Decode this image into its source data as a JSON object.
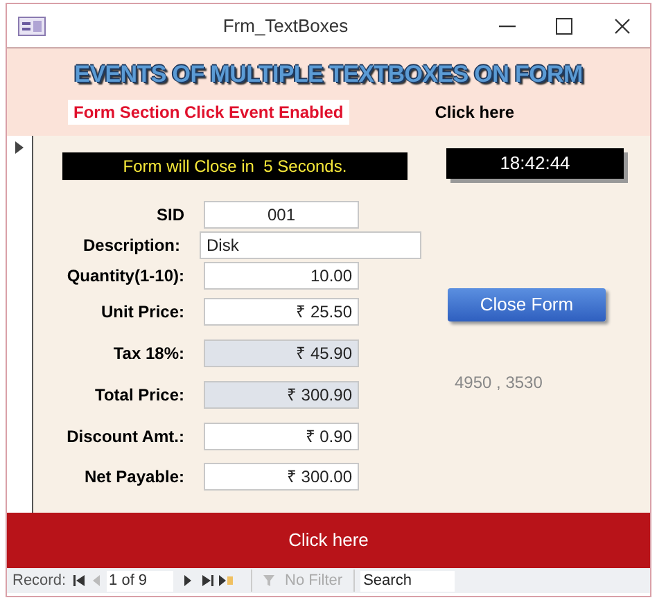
{
  "window": {
    "title": "Frm_TextBoxes"
  },
  "header": {
    "title": "EVENTS OF MULTIPLE TEXTBOXES ON FORM",
    "status_label": "Form Section Click Event Enabled",
    "click_label": "Click here"
  },
  "detail": {
    "banner": "Form will Close in  5 Seconds.",
    "clock": "18:42:44",
    "fields": [
      {
        "kind": "code",
        "label": "SID",
        "value": "001",
        "locked": false
      },
      {
        "kind": "text",
        "label": "Description:",
        "value": "Disk",
        "locked": false
      },
      {
        "kind": "number",
        "label": "Quantity(1-10):",
        "value": "10.00",
        "locked": false
      },
      {
        "kind": "number",
        "label": "Unit Price:",
        "value": "₹ 25.50",
        "locked": false
      },
      {
        "kind": "number",
        "label": "Tax 18%:",
        "value": "₹ 45.90",
        "locked": true
      },
      {
        "kind": "number",
        "label": "Total Price:",
        "value": "₹ 300.90",
        "locked": true
      },
      {
        "kind": "number",
        "label": "Discount Amt.:",
        "value": "₹ 0.90",
        "locked": false
      },
      {
        "kind": "number",
        "label": "Net Payable:",
        "value": "₹ 300.00",
        "locked": false
      }
    ],
    "close_button": "Close Form",
    "coordinates": "4950 , 3530"
  },
  "footer": {
    "button": "Click here"
  },
  "navigation": {
    "record_label": "Record:",
    "position": "1 of 9",
    "filter": {
      "label": "No Filter",
      "disabled": true
    },
    "search": {
      "placeholder": "Search"
    }
  }
}
